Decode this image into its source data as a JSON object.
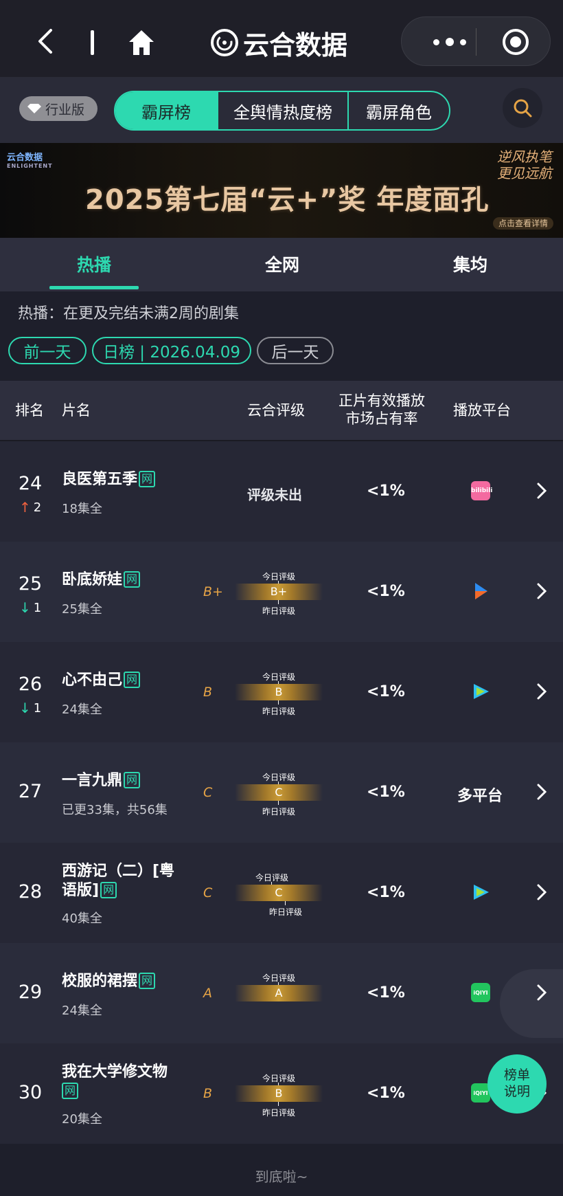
{
  "app": {
    "title": "云合数据",
    "icons": [
      "back-icon",
      "home-icon",
      "more-icon",
      "mini-program-close-icon",
      "search-icon"
    ]
  },
  "top_controls": {
    "industry_label": "行业版",
    "segments": [
      {
        "label": "霸屏榜",
        "active": true
      },
      {
        "label": "全舆情热度榜",
        "active": false
      },
      {
        "label": "霸屏角色",
        "active": false
      }
    ]
  },
  "banner": {
    "logo_text": "云合数据",
    "logo_sub": "ENLIGHTENT",
    "title": "2025第七届“云+”奖  年度面孔",
    "slogan": "逆风执笔 更见远航",
    "cta": "点击查看详情"
  },
  "tabs": [
    {
      "label": "热播",
      "active": true
    },
    {
      "label": "全网",
      "active": false
    },
    {
      "label": "集均",
      "active": false
    }
  ],
  "description": "热播：在更及完结未满2周的剧集",
  "date_nav": {
    "prev": "前一天",
    "current": "日榜 | 2026.04.09",
    "next": "后一天"
  },
  "table": {
    "headers": {
      "rank": "排名",
      "title": "片名",
      "grade": "云合评级",
      "share_line1": "正片有效播放",
      "share_line2": "市场占有率",
      "platform": "播放平台"
    },
    "grade_today_label": "今日评级",
    "grade_yesterday_label": "昨日评级",
    "net_badge": "网",
    "rows": [
      {
        "rank": "24",
        "change_dir": "up",
        "change_symbol": "↑",
        "change": "2",
        "name": "良医第五季",
        "episodes": "18集全",
        "grade_letter": "",
        "grade": "",
        "grade_text": "评级未出",
        "share": "<1%",
        "platform": "bilibili",
        "platform_text": ""
      },
      {
        "rank": "25",
        "change_dir": "down",
        "change_symbol": "↓",
        "change": "1",
        "name": "卧底娇娃",
        "episodes": "25集全",
        "grade_letter": "B+",
        "grade": "B+",
        "grade_text": "",
        "share": "<1%",
        "platform": "youku",
        "platform_text": ""
      },
      {
        "rank": "26",
        "change_dir": "down",
        "change_symbol": "↓",
        "change": "1",
        "name": "心不由己",
        "episodes": "24集全",
        "grade_letter": "B",
        "grade": "B",
        "grade_text": "",
        "share": "<1%",
        "platform": "tencent",
        "platform_text": ""
      },
      {
        "rank": "27",
        "change_dir": "",
        "change_symbol": "",
        "change": "",
        "name": "一言九鼎",
        "episodes": "已更33集，共56集",
        "grade_letter": "C",
        "grade": "C",
        "grade_text": "",
        "share": "<1%",
        "platform": "",
        "platform_text": "多平台"
      },
      {
        "rank": "28",
        "change_dir": "",
        "change_symbol": "",
        "change": "",
        "name_line1": "西游记（二）[粤",
        "name_line2": "语版]",
        "episodes": "40集全",
        "grade_letter": "C",
        "grade": "C",
        "grade_text": "",
        "share": "<1%",
        "platform": "tencent",
        "platform_text": ""
      },
      {
        "rank": "29",
        "change_dir": "",
        "change_symbol": "",
        "change": "",
        "name": "校服的裙摆",
        "episodes": "24集全",
        "grade_letter": "A",
        "grade": "A",
        "grade_text": "",
        "share": "<1%",
        "platform": "iqiyi",
        "platform_text": ""
      },
      {
        "rank": "30",
        "change_dir": "",
        "change_symbol": "",
        "change": "",
        "name": "我在大学修文物",
        "episodes": "20集全",
        "grade_letter": "B",
        "grade": "B",
        "grade_text": "",
        "share": "<1%",
        "platform": "iqiyi",
        "platform_text": ""
      }
    ]
  },
  "iqiyi_logo_text": "iQIYI",
  "bili_logo_text": "bilibili",
  "footer": "到底啦~",
  "fab_label_line1": "榜单",
  "fab_label_line2": "说明",
  "colors": {
    "accent": "#2dd9b0",
    "up": "#f0623f",
    "grade": "#e6a446"
  }
}
